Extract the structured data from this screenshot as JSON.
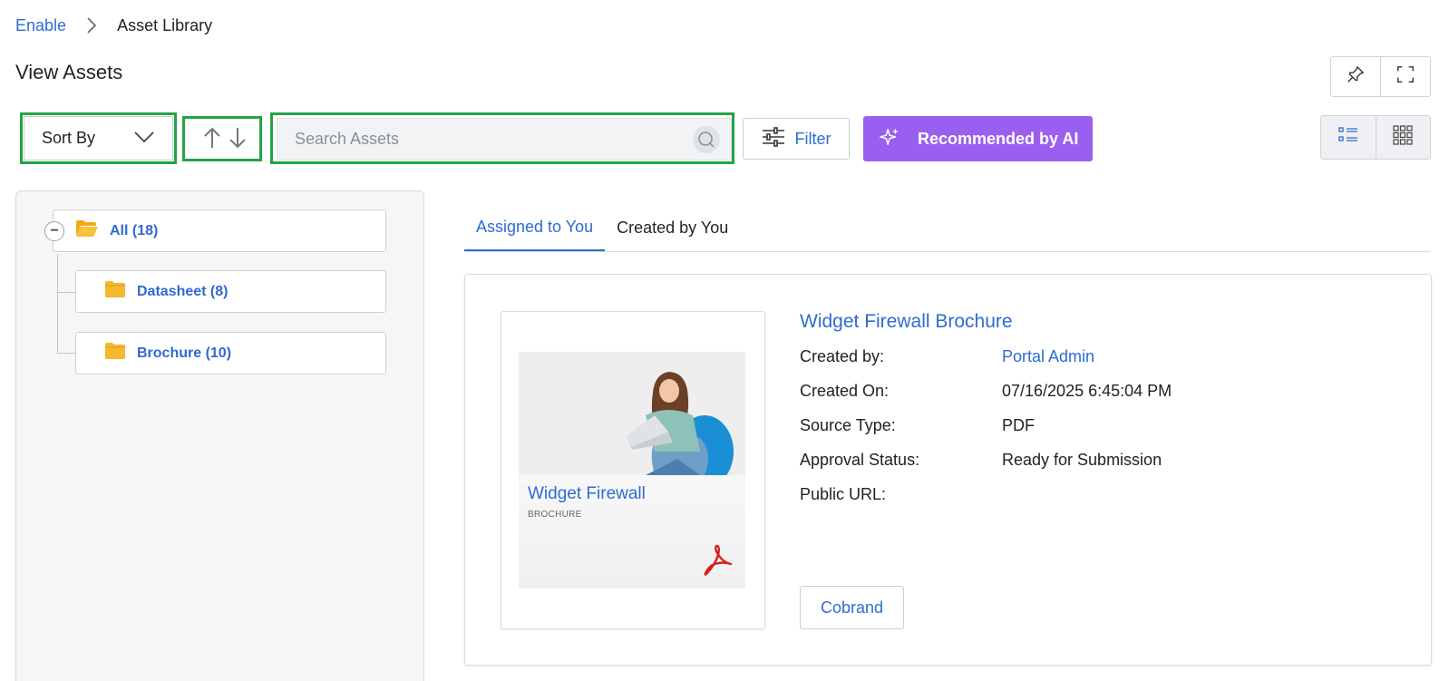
{
  "breadcrumb": {
    "root": "Enable",
    "current": "Asset Library"
  },
  "page": {
    "title": "View Assets"
  },
  "toolbar": {
    "sort_label": "Sort By",
    "search_placeholder": "Search Assets",
    "filter_label": "Filter",
    "ai_label": "Recommended by AI"
  },
  "tree": {
    "root": {
      "label": "All (18)",
      "expanded": true
    },
    "children": [
      {
        "label": "Datasheet (8)"
      },
      {
        "label": "Brochure (10)"
      }
    ]
  },
  "tabs": [
    {
      "label": "Assigned to You",
      "active": true
    },
    {
      "label": "Created by You",
      "active": false
    }
  ],
  "asset": {
    "title": "Widget Firewall Brochure",
    "thumbnail": {
      "title": "Widget Firewall",
      "subtitle": "BROCHURE",
      "file_icon": "pdf-icon"
    },
    "fields": [
      {
        "label": "Created by:",
        "value": "Portal Admin",
        "is_link": true
      },
      {
        "label": "Created On:",
        "value": "07/16/2025 6:45:04 PM",
        "is_link": false
      },
      {
        "label": "Source Type:",
        "value": "PDF",
        "is_link": false
      },
      {
        "label": "Approval Status:",
        "value": "Ready for Submission",
        "is_link": false
      },
      {
        "label": "Public URL:",
        "value": "",
        "is_link": false
      }
    ],
    "cobrand_label": "Cobrand"
  },
  "colors": {
    "link": "#2f6bd1",
    "ai_button": "#9b5ff0",
    "highlight": "#22a447",
    "folder": "#f5b82e"
  }
}
